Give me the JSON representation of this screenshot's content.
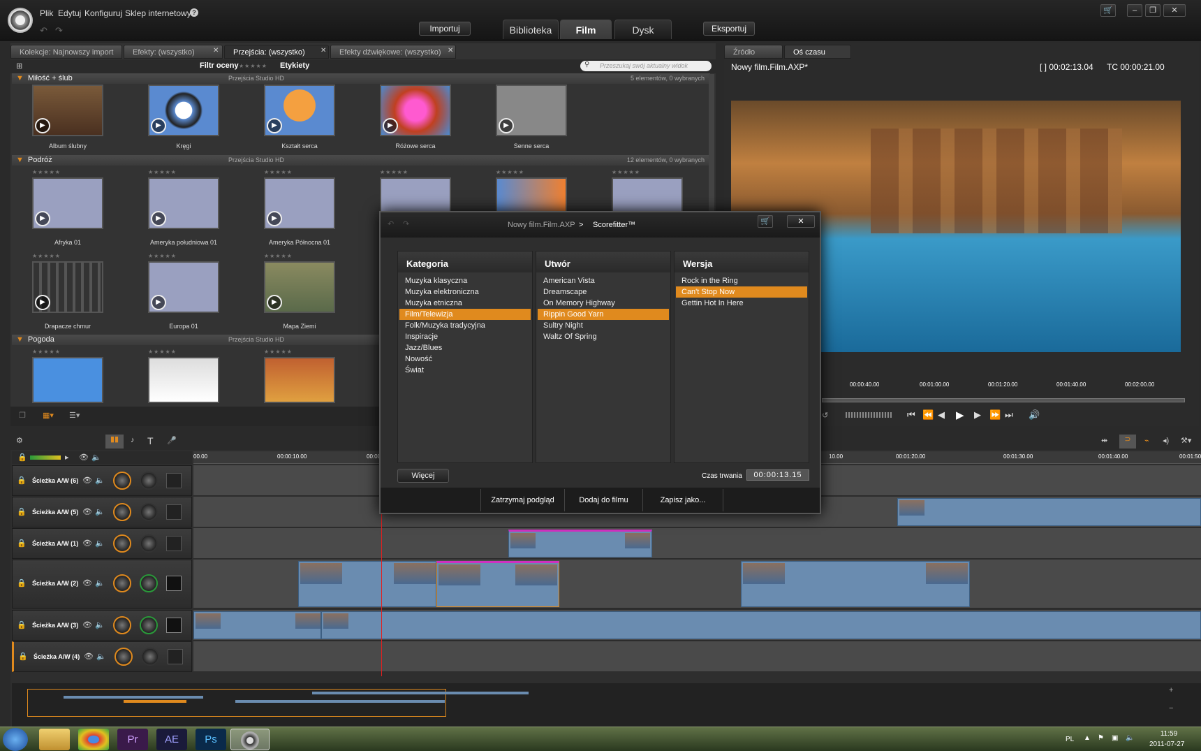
{
  "menu": {
    "file": "Plik",
    "edit": "Edytuj",
    "configure": "Konfiguruj",
    "shop": "Sklep internetowy",
    "help": "?"
  },
  "header": {
    "import": "Importuj",
    "export": "Eksportuj",
    "tabs": [
      "Biblioteka",
      "Film",
      "Dysk"
    ]
  },
  "library": {
    "tabs": [
      "Kolekcje: Najnowszy import",
      "Efekty: (wszystko)",
      "Przejścia: (wszystko)",
      "Efekty dźwiękowe: (wszystko)"
    ],
    "filter_label": "Filtr oceny",
    "tags_label": "Etykiety",
    "search_placeholder": "Przeszukaj swój aktualny widok",
    "groups": [
      {
        "name": "Miłość + ślub",
        "source": "Przejścia Studio HD",
        "count": "5 elementów, 0 wybranych",
        "items": [
          "Album ślubny",
          "Kręgi",
          "Kształt serca",
          "Różowe serca",
          "Senne serca"
        ]
      },
      {
        "name": "Podróż",
        "source": "Przejścia Studio HD",
        "count": "12 elementów, 0 wybranych",
        "items": [
          "Afryka 01",
          "Ameryka południowa 01",
          "Ameryka Północna 01",
          "Drapacze chmur",
          "Europa 01",
          "Mapa Ziemi"
        ]
      },
      {
        "name": "Pogoda",
        "source": "Przejścia Studio HD"
      }
    ]
  },
  "preview": {
    "tabs": [
      "Źródło",
      "Oś czasu"
    ],
    "title": "Nowy film.Film.AXP*",
    "duration": "[ ] 00:02:13.04",
    "tc": "TC 00:00:21.00",
    "ruler": [
      "00:00:40.00",
      "00:01:00.00",
      "00:01:20.00",
      "00:01:40.00",
      "00:02:00.00"
    ]
  },
  "timeline": {
    "ruler": [
      "00.00",
      "00:00:10.00",
      "00:00:2",
      "10.00",
      "00:01:20.00",
      "00:01:30.00",
      "00:01:40.00",
      "00:01:50"
    ],
    "tracks": [
      "Ścieżka A/W (6)",
      "Ścieżka A/W (5)",
      "Ścieżka A/W (1)",
      "Ścieżka A/W (2)",
      "Ścieżka A/W (3)",
      "Ścieżka A/W (4)"
    ]
  },
  "dialog": {
    "path": "Nowy film.Film.AXP",
    "arrow": ">",
    "title": "Scorefitter™",
    "category_header": "Kategoria",
    "song_header": "Utwór",
    "version_header": "Wersja",
    "categories": [
      "Muzyka klasyczna",
      "Muzyka elektroniczna",
      "Muzyka etniczna",
      "Film/Telewizja",
      "Folk/Muzyka tradycyjna",
      "Inspiracje",
      "Jazz/Blues",
      "Nowość",
      "Świat"
    ],
    "songs": [
      "American Vista",
      "Dreamscape",
      "On Memory Highway",
      "Rippin Good Yarn",
      "Sultry Night",
      "Waltz Of Spring"
    ],
    "versions": [
      "Rock in the Ring",
      "Can't Stop Now",
      "Gettin Hot In Here"
    ],
    "more": "Więcej",
    "duration_label": "Czas trwania",
    "duration": "00:00:13.15",
    "stop": "Zatrzymaj podgląd",
    "add": "Dodaj do filmu",
    "save": "Zapisz jako..."
  },
  "taskbar": {
    "lang": "PL",
    "time": "11:59",
    "date": "2011-07-27",
    "apps": [
      "Pr",
      "AE",
      "Ps"
    ]
  },
  "colors": {
    "accent": "#e08a1e",
    "clip": "#6a8cb0"
  }
}
